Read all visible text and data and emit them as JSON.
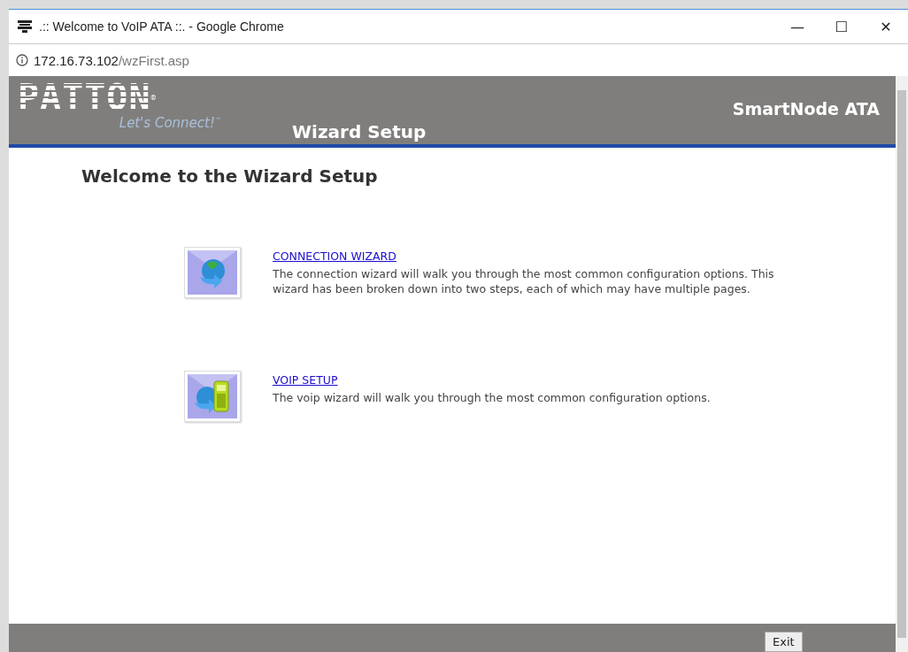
{
  "window": {
    "title": ".:: Welcome to VoIP ATA ::. - Google Chrome",
    "controls": [
      "—",
      "☐",
      "✕"
    ]
  },
  "address": {
    "host": "172.16.73.102",
    "path": "/wzFirst.asp"
  },
  "header": {
    "logo": "PATTON",
    "logo_mark": "®",
    "tagline": "Let's Connect!",
    "tagline_mark": "™",
    "section": "Wizard Setup",
    "product": "SmartNode ATA"
  },
  "heading": "Welcome to the Wizard Setup",
  "wizards": [
    {
      "kind": "connection",
      "link": "CONNECTION WIZARD",
      "description": "The connection wizard will walk you through the most common configuration options. This wizard has been broken down into two steps, each of which may have multiple pages."
    },
    {
      "kind": "voip",
      "link": "VOIP SETUP",
      "description": "The voip wizard will walk you through the most common configuration options."
    }
  ],
  "footer": {
    "button": "Exit"
  }
}
